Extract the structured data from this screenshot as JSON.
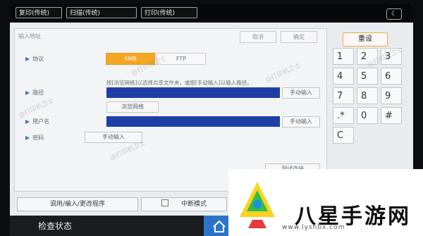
{
  "tabs": [
    {
      "label": "复印(传统)"
    },
    {
      "label": "扫描(传统)"
    },
    {
      "label": "打印(传统)"
    }
  ],
  "moon_icon": "moon-icon",
  "panel": {
    "title": "输入地址",
    "cancel": "取消",
    "confirm": "确定"
  },
  "protocol": {
    "label": "协议",
    "options": [
      "SMB",
      "FTP"
    ],
    "selected": "SMB"
  },
  "hint": "按[浏览网络]以选择共享文件夹，或按[手动输入]以输入路径。",
  "path": {
    "label": "路径",
    "manual": "手动输入",
    "browse": "浏览网络"
  },
  "username": {
    "label": "用户名",
    "manual": "手动输入"
  },
  "password": {
    "label": "密码",
    "manual": "手动输入"
  },
  "test_connection": "测试连接",
  "keypad": {
    "reset": "重设",
    "keys": [
      "1",
      "2",
      "3",
      "4",
      "5",
      "6",
      "7",
      "8",
      "9",
      ".*",
      "0",
      "#",
      "C"
    ]
  },
  "bottom": {
    "program": "调用/编入/更改程序",
    "interrupt": "中断模式"
  },
  "status": "检查状态",
  "watermarks": [
    "@打印机卫士",
    "@打印机卫士",
    "@打印机卫士",
    "@打印机卫士",
    "@打印机卫士"
  ],
  "logo": {
    "name": "八星手游网",
    "url": "www.lyshbx.com"
  }
}
